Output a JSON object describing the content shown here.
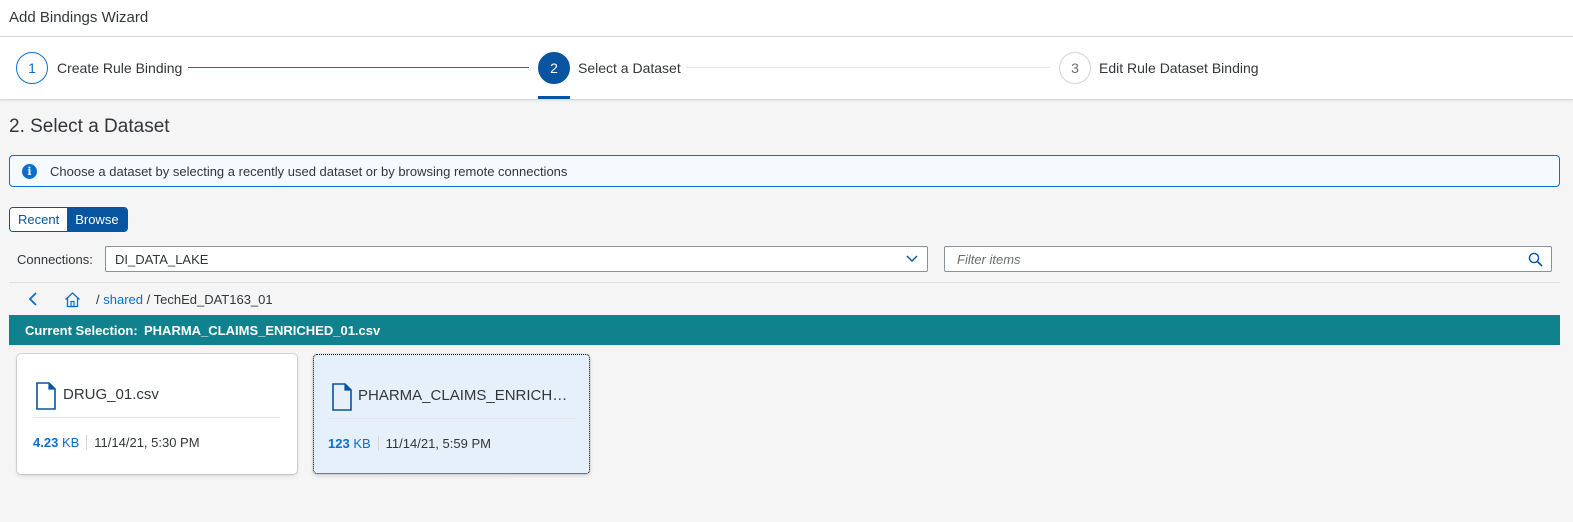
{
  "window": {
    "title": "Add Bindings Wizard"
  },
  "wizard": {
    "steps": [
      {
        "number": "1",
        "label": "Create Rule Binding",
        "state": "done"
      },
      {
        "number": "2",
        "label": "Select a Dataset",
        "state": "active"
      },
      {
        "number": "3",
        "label": "Edit Rule Dataset Binding",
        "state": "todo"
      }
    ]
  },
  "page": {
    "title": "2. Select a Dataset"
  },
  "info": {
    "icon": "info-icon",
    "glyph": "i",
    "text": "Choose a dataset by selecting a recently used dataset or by browsing remote connections"
  },
  "toggle": {
    "recent_label": "Recent",
    "browse_label": "Browse",
    "selected": "Browse"
  },
  "connections": {
    "label": "Connections:",
    "value": "DI_DATA_LAKE"
  },
  "filter": {
    "placeholder": "Filter items",
    "value": ""
  },
  "breadcrumb": {
    "root_sep": "/",
    "link": "shared",
    "sep": " / ",
    "current": "TechEd_DAT163_01"
  },
  "selection": {
    "label": "Current Selection:",
    "value": "PHARMA_CLAIMS_ENRICHED_01.csv"
  },
  "files": [
    {
      "name": "DRUG_01.csv",
      "size_num": "4.23",
      "size_unit": "KB",
      "date": "11/14/21, 5:30 PM",
      "selected": false
    },
    {
      "name": "PHARMA_CLAIMS_ENRICHED_01.csv",
      "size_num": "123",
      "size_unit": "KB",
      "date": "11/14/21, 5:59 PM",
      "selected": true
    }
  ],
  "colors": {
    "accent": "#0854a0",
    "link": "#0a6ed1",
    "selection_bar": "#10828e"
  }
}
